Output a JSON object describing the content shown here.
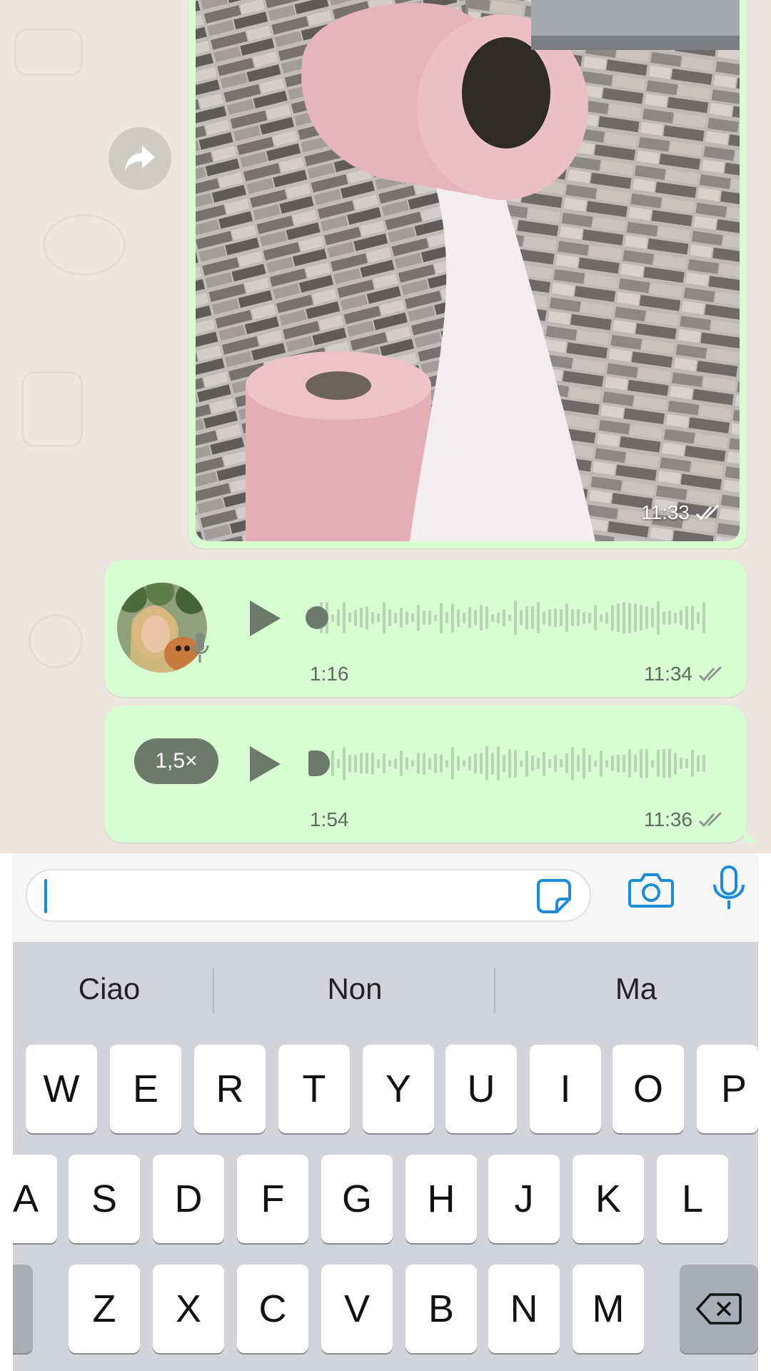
{
  "image_message": {
    "time": "11:33"
  },
  "voice_messages": [
    {
      "duration": "1:16",
      "time": "11:34",
      "progress": 0
    },
    {
      "duration": "1:54",
      "time": "11:36",
      "playback_speed": "1,5×",
      "progress": 0
    }
  ],
  "input": {
    "value": "",
    "placeholder": ""
  },
  "keyboard": {
    "suggestions": [
      "Ciao",
      "Non",
      "Ma"
    ],
    "row1": [
      "W",
      "E",
      "R",
      "T",
      "Y",
      "U",
      "I",
      "O",
      "P"
    ],
    "row2": [
      "A",
      "S",
      "D",
      "F",
      "G",
      "H",
      "J",
      "K",
      "L"
    ],
    "row3": [
      "Z",
      "X",
      "C",
      "V",
      "B",
      "N",
      "M"
    ]
  },
  "colors": {
    "outgoing_bubble": "#d9fdd3",
    "chat_background": "#ece7e0",
    "accent_blue": "#1a8cd8",
    "waveform_played": "#6c7a6c",
    "waveform_unplayed": "#b7d3b1"
  },
  "icons": [
    "forward-icon",
    "play-icon",
    "microphone-icon",
    "read-receipt-icon",
    "sticker-icon",
    "camera-icon",
    "backspace-icon"
  ]
}
